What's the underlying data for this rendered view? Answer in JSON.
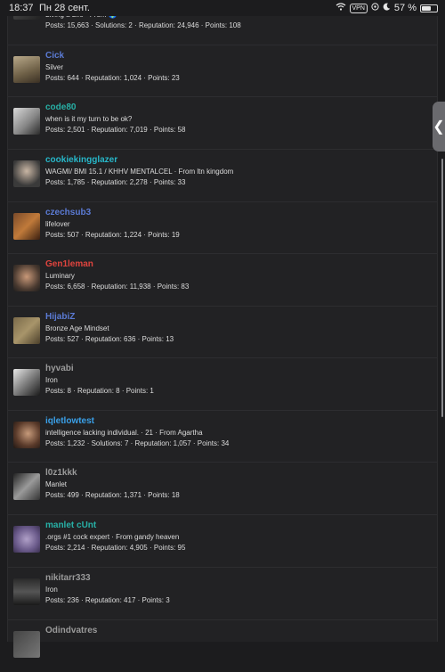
{
  "statusbar": {
    "time": "18:37",
    "date": "Пн 28 сент.",
    "vpn": "VPN",
    "battery": "57 %",
    "battery_level": 0.57,
    "icons": [
      "wifi-icon",
      "vpn-icon",
      "location-icon",
      "moon-icon",
      "battery-icon"
    ]
  },
  "side_handle": {
    "glyph": "❮"
  },
  "members": [
    {
      "name": "",
      "name_color": "#6a8dd8",
      "title": "Living a Life · From 🌍",
      "stats": "Posts: 15,663 · Solutions: 2 · Reputation: 24,946 · Points: 108"
    },
    {
      "name": "Cick",
      "name_color": "#5b7bd5",
      "title": "Silver",
      "stats": "Posts: 644 · Reputation: 1,024 · Points: 23"
    },
    {
      "name": "code80",
      "name_color": "#27b0a6",
      "title": "when is it my turn to be ok?",
      "stats": "Posts: 2,501 · Reputation: 7,019 · Points: 58"
    },
    {
      "name": "cookiekingglazer",
      "name_color": "#27b7c9",
      "title": "WAGMI/ BMI 15.1 / KHHV MENTALCEL · From ltn kingdom",
      "stats": "Posts: 1,785 · Reputation: 2,278 · Points: 33"
    },
    {
      "name": "czechsub3",
      "name_color": "#5b7bd5",
      "title": "lifelover",
      "stats": "Posts: 507 · Reputation: 1,224 · Points: 19"
    },
    {
      "name": "Gen1leman",
      "name_color": "#e0443e",
      "title": "Luminary",
      "stats": "Posts: 6,658 · Reputation: 11,938 · Points: 83"
    },
    {
      "name": "HijabiZ",
      "name_color": "#5b7bd5",
      "title": "Bronze Age Mindset",
      "stats": "Posts: 527 · Reputation: 636 · Points: 13"
    },
    {
      "name": "hyvabi",
      "name_color": "#9a9a9a",
      "title": "Iron",
      "stats": "Posts: 8 · Reputation: 8 · Points: 1"
    },
    {
      "name": "iqletlowtest",
      "name_color": "#3aa0e8",
      "title": "intelligence lacking individual. · 21 · From Agartha",
      "stats": "Posts: 1,232 · Solutions: 7 · Reputation: 1,057 · Points: 34"
    },
    {
      "name": "l0z1kkk",
      "name_color": "#9a9a9a",
      "title": "Manlet",
      "stats": "Posts: 499 · Reputation: 1,371 · Points: 18"
    },
    {
      "name": "manlet cUnt",
      "name_color": "#27b0a6",
      "title": ".orgs #1 cock expert · From gandy heaven",
      "stats": "Posts: 2,214 · Reputation: 4,905 · Points: 95"
    },
    {
      "name": "nikitarr333",
      "name_color": "#9a9a9a",
      "title": "Iron",
      "stats": "Posts: 236 · Reputation: 417 · Points: 3"
    },
    {
      "name": "Odindvatres",
      "name_color": "#9a9a9a",
      "title": "",
      "stats": ""
    }
  ]
}
